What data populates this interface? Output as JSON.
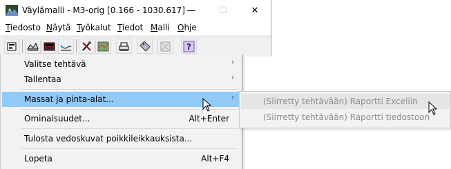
{
  "window": {
    "title": "Väylämalli - M3-orig  [0.166 - 1030.617]",
    "app_icon": "mountain-map-icon",
    "controls": {
      "minimize": "—",
      "maximize": "☐",
      "close": "✕"
    }
  },
  "menubar": {
    "items": [
      "Tiedosto",
      "Näytä",
      "Työkalut",
      "Tiedot",
      "Malli",
      "Ohje"
    ]
  },
  "toolbar": {
    "icons": [
      "properties-icon",
      "terrain-icon",
      "layers-icon",
      "profile-icon",
      "tools-icon",
      "map-icon",
      "print-icon",
      "tag-icon",
      "image-icon",
      "help-icon"
    ],
    "help_glyph": "?"
  },
  "dropdown": {
    "items": [
      {
        "label": "Valitse tehtävä",
        "shortcut": "",
        "submenu": true,
        "highlighted": false
      },
      {
        "label": "Tallentaa",
        "shortcut": "",
        "submenu": true,
        "highlighted": false
      },
      {
        "label": "Massat ja pinta-alat...",
        "shortcut": "",
        "submenu": true,
        "highlighted": true
      },
      {
        "label": "Ominaisuudet...",
        "shortcut": "Alt+Enter",
        "submenu": false,
        "highlighted": false
      },
      {
        "label": "Tulosta vedoskuvat poikkileikkauksista...",
        "shortcut": "",
        "submenu": false,
        "highlighted": false
      },
      {
        "label": "Lopeta",
        "shortcut": "Alt+F4",
        "submenu": false,
        "highlighted": false
      }
    ],
    "arrow_glyph": "›"
  },
  "submenu": {
    "items": [
      {
        "label": "(Siirretty tehtävään) Raportti Exceliin",
        "disabled": true,
        "highlighted": true
      },
      {
        "label": "(Siirretty tehtävään) Raportti tiedostoon",
        "disabled": true,
        "highlighted": false
      }
    ]
  },
  "colors": {
    "highlight": "#91c9f7",
    "menu_bg": "#f2f2f2",
    "disabled_text": "#8b8b8b"
  }
}
